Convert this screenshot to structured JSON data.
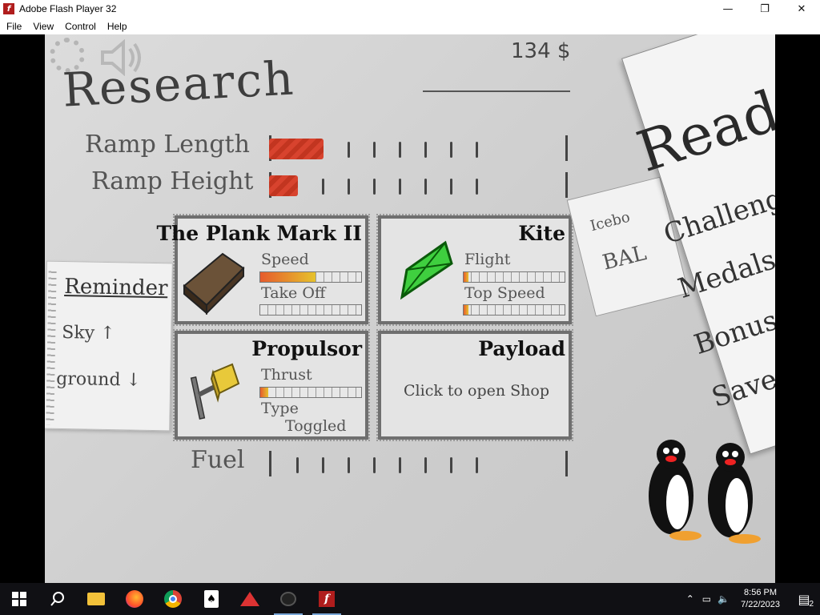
{
  "window": {
    "title": "Adobe Flash Player 32",
    "controls": {
      "minimize": "—",
      "restore": "❐",
      "close": "✕"
    }
  },
  "menubar": [
    "File",
    "View",
    "Control",
    "Help"
  ],
  "game": {
    "title": "Research",
    "money": "134 $",
    "upgrades": [
      {
        "label": "Ramp Length",
        "level": 2,
        "max": 9
      },
      {
        "label": "Ramp Height",
        "level": 1,
        "max": 9
      }
    ],
    "fuel": {
      "label": "Fuel",
      "level": 0,
      "max": 9
    },
    "panels": {
      "plank": {
        "title": "The Plank Mark II",
        "stat1": "Speed",
        "stat1_level": 0.55,
        "stat2": "Take Off",
        "stat2_level": 0.0
      },
      "kite": {
        "title": "Kite",
        "stat1": "Flight",
        "stat1_level": 0.05,
        "stat2": "Top Speed",
        "stat2_level": 0.05
      },
      "propulsor": {
        "title": "Propulsor",
        "stat1": "Thrust",
        "stat1_level": 0.08,
        "stat2": "Type",
        "type_value": "Toggled"
      },
      "payload": {
        "title": "Payload",
        "note": "Click to open Shop"
      }
    },
    "reminder": {
      "title": "Reminder",
      "line1": "Sky ↑",
      "line2": "ground ↓"
    },
    "side_menu": {
      "heading": "Read",
      "items": [
        "Challenge",
        "Medals",
        "Bonus",
        "Save"
      ],
      "back_paper_line1": "Icebo",
      "back_paper_line2": "BAL"
    }
  },
  "taskbar": {
    "time": "8:56 PM",
    "date": "7/22/2023",
    "notifications": "2"
  },
  "colors": {
    "fill_red": "#d8432e",
    "panel_border": "#6f6f6f"
  }
}
